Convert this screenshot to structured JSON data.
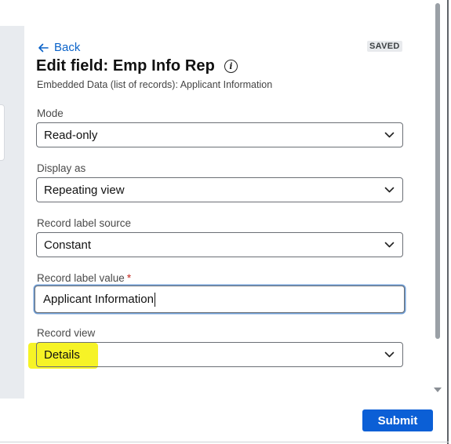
{
  "header": {
    "back_label": "Back",
    "status_badge": "SAVED",
    "title": "Edit field: Emp Info Rep",
    "subtitle": "Embedded Data (list of records): Applicant Information",
    "info_icon": "info-icon"
  },
  "fields": {
    "mode": {
      "label": "Mode",
      "value": "Read-only"
    },
    "display_as": {
      "label": "Display as",
      "value": "Repeating view"
    },
    "record_label_source": {
      "label": "Record label source",
      "value": "Constant"
    },
    "record_label_value": {
      "label": "Record label value",
      "required_mark": "*",
      "value": "Applicant Information"
    },
    "record_view": {
      "label": "Record view",
      "value": "Details"
    }
  },
  "footer": {
    "submit_label": "Submit"
  },
  "colors": {
    "accent": "#0b5fd6",
    "link": "#0b63c9",
    "highlight": "#f5f21a",
    "required": "#c4261d"
  }
}
